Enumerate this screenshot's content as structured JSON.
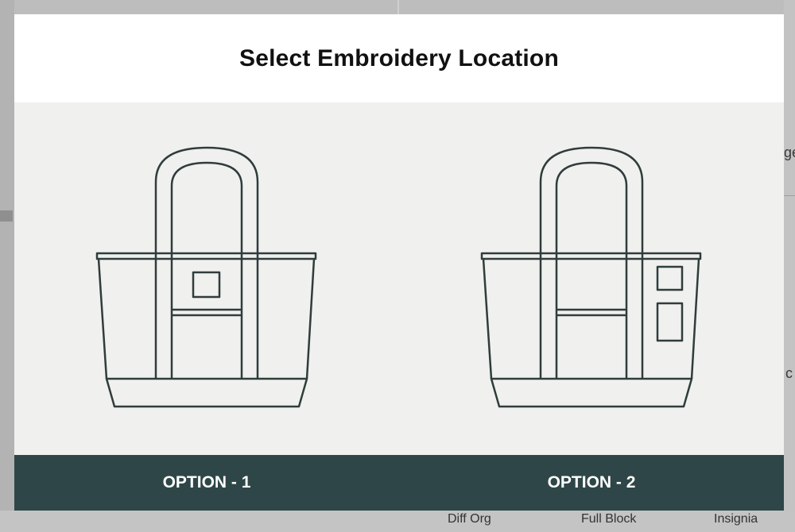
{
  "modal": {
    "title": "Select Embroidery Location",
    "options": [
      {
        "label": "OPTION - 1"
      },
      {
        "label": "OPTION - 2"
      }
    ]
  },
  "background": {
    "bottom_labels": [
      "Diff Org",
      "Full Block",
      "Insignia"
    ],
    "side_fragments": [
      "ge",
      "c"
    ]
  },
  "colors": {
    "footer_bg": "#2e4647",
    "bag_stroke": "#2f3d3c",
    "canvas_bg": "#f0f0ee"
  }
}
